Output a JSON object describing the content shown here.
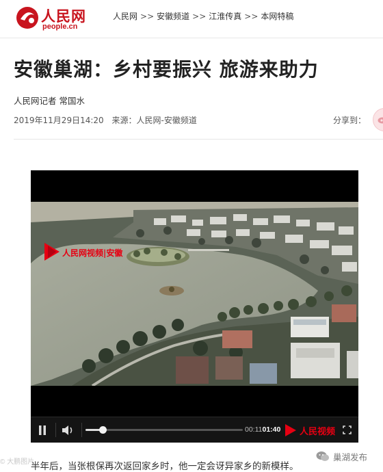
{
  "header": {
    "logo": {
      "cn": "人民网",
      "en": "people.cn"
    },
    "breadcrumb": [
      "人民网",
      "安徽频道",
      "江淮传真",
      "本网特稿"
    ],
    "separator": ">>"
  },
  "article": {
    "title": "安徽巢湖：乡村要振兴 旅游来助力",
    "byline": "人民网记者 常国水",
    "date": "2019年11月29日14:20",
    "source": "来源：人民网-安徽频道",
    "share_label": "分享到：",
    "paragraph": "半年后，当张根保再次返回家乡时，他一定会讶异家乡的新模样。"
  },
  "video": {
    "overlay_logo": "人民网视频|安徽",
    "current_time": "00:11",
    "total_time": "01:40",
    "progress": 0.11,
    "brand": "人民视频"
  },
  "watermarks": {
    "left": "© 大鹏图片",
    "right": "巢湖发布"
  },
  "colors": {
    "brand_red": "#c8141e",
    "video_red": "#e60012"
  }
}
